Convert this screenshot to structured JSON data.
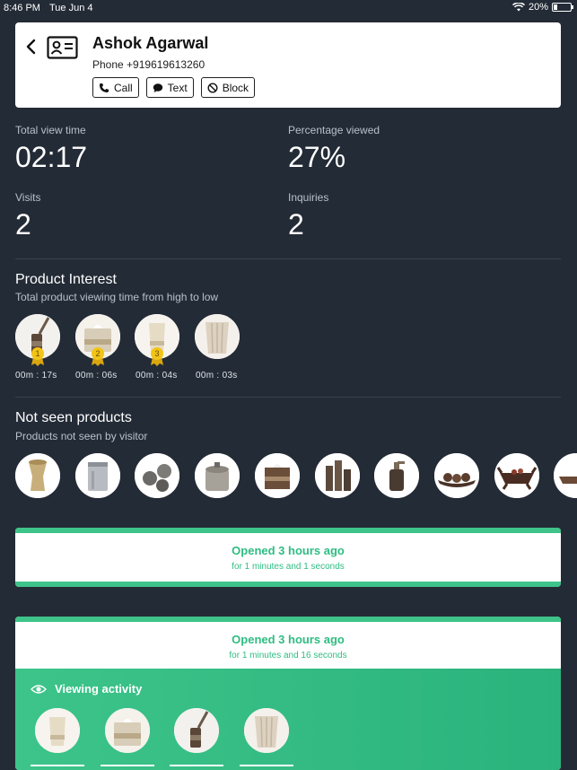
{
  "status_bar": {
    "time": "8:46 PM",
    "date": "Tue Jun 4",
    "battery": "20%",
    "battery_level": 0.2
  },
  "contact": {
    "name": "Ashok Agarwal",
    "phone": "Phone +919619613260",
    "actions": [
      {
        "label": "Call",
        "icon": "phone-icon"
      },
      {
        "label": "Text",
        "icon": "chat-bubble-icon"
      },
      {
        "label": "Block",
        "icon": "block-icon"
      }
    ]
  },
  "stats": {
    "total_view_time": {
      "label": "Total view time",
      "value": "02:17"
    },
    "percentage_viewed": {
      "label": "Percentage viewed",
      "value": "27%"
    },
    "visits": {
      "label": "Visits",
      "value": "2"
    },
    "inquiries": {
      "label": "Inquiries",
      "value": "2"
    }
  },
  "product_interest": {
    "title": "Product Interest",
    "subtitle": "Total product viewing time from high to low",
    "items": [
      {
        "rank": "1",
        "time": "00m :  17s"
      },
      {
        "rank": "2",
        "time": "00m : 06s"
      },
      {
        "rank": "3",
        "time": "00m : 04s"
      },
      {
        "rank": "",
        "time": "00m : 03s"
      }
    ]
  },
  "not_seen": {
    "title": "Not seen products",
    "subtitle": "Products not seen by visitor"
  },
  "sessions": [
    {
      "title": "Opened 3 hours ago",
      "subtitle": "for 1 minutes and 1 seconds"
    },
    {
      "title": "Opened 3 hours ago",
      "subtitle": "for 1 minutes and 16 seconds",
      "activity_label": "Viewing activity"
    }
  ],
  "colors": {
    "background": "#232b36",
    "accent_green": "#2ebd82",
    "medal_gold": "#f2c417"
  }
}
